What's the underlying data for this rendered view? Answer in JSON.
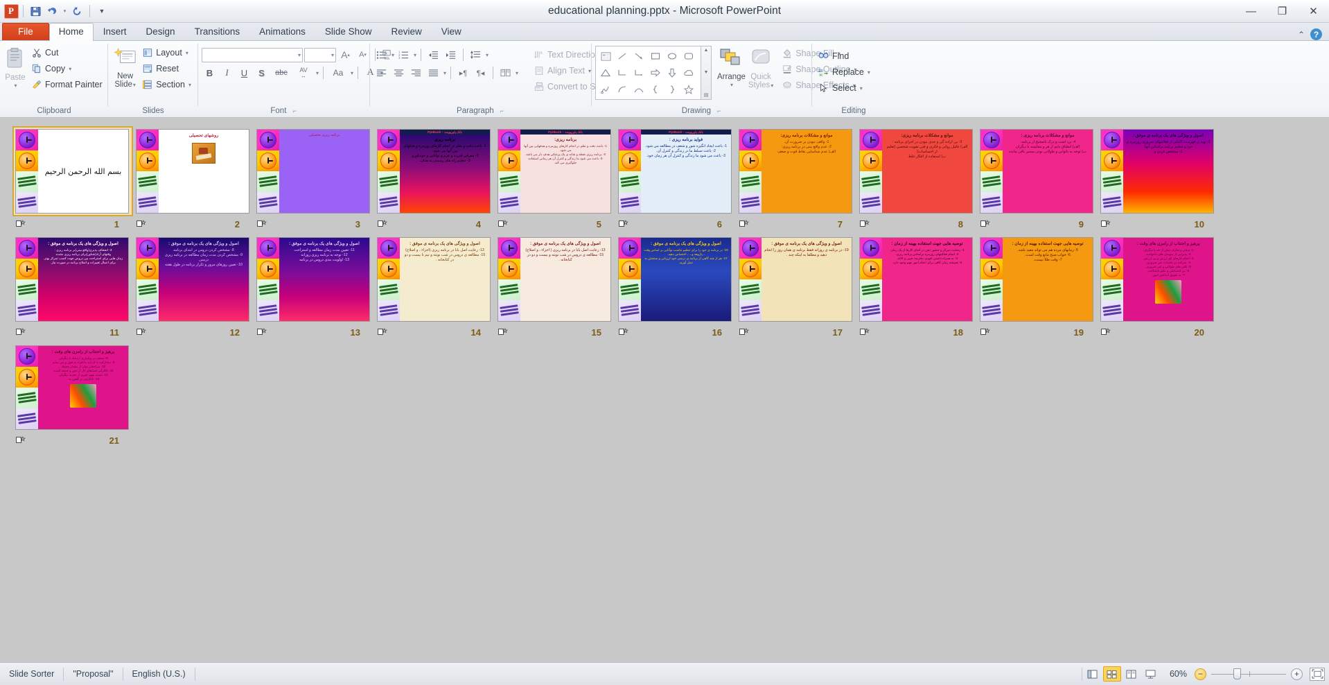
{
  "window": {
    "title": "educational planning.pptx - Microsoft PowerPoint",
    "app_logo": "P",
    "minimize": "—",
    "restore": "❐",
    "close": "✕"
  },
  "quick_access": [
    {
      "name": "save",
      "glyph": "💾"
    },
    {
      "name": "undo",
      "glyph": "↰"
    },
    {
      "name": "undo-dropdown",
      "glyph": "▾"
    },
    {
      "name": "redo",
      "glyph": "↻"
    },
    {
      "name": "customize-qat",
      "glyph": "▼"
    }
  ],
  "tabs": [
    {
      "label": "File",
      "kind": "file"
    },
    {
      "label": "Home",
      "kind": "active"
    },
    {
      "label": "Insert",
      "kind": "normal"
    },
    {
      "label": "Design",
      "kind": "normal"
    },
    {
      "label": "Transitions",
      "kind": "normal"
    },
    {
      "label": "Animations",
      "kind": "normal"
    },
    {
      "label": "Slide Show",
      "kind": "normal"
    },
    {
      "label": "Review",
      "kind": "normal"
    },
    {
      "label": "View",
      "kind": "normal"
    }
  ],
  "tab_right": {
    "minimize_ribbon": "⌃",
    "help": "?"
  },
  "ribbon": {
    "clipboard": {
      "label": "Clipboard",
      "paste": {
        "label": "Paste",
        "glyph": "📋",
        "caret": "▾"
      },
      "items": [
        {
          "label": "Cut",
          "glyph": "✂",
          "icon_name": "cut-icon"
        },
        {
          "label": "Copy",
          "glyph": "⧉",
          "icon_name": "copy-icon",
          "caret": "▾"
        },
        {
          "label": "Format Painter",
          "glyph": "🖌",
          "icon_name": "format-painter-icon"
        }
      ]
    },
    "slides": {
      "label": "Slides",
      "new_slide": {
        "label1": "New",
        "label2": "Slide",
        "glyph": "▤",
        "caret": "▾"
      },
      "items": [
        {
          "label": "Layout",
          "glyph": "▤",
          "icon_name": "layout-icon",
          "caret": "▾"
        },
        {
          "label": "Reset",
          "glyph": "▣",
          "icon_name": "reset-icon"
        },
        {
          "label": "Section",
          "glyph": "▥",
          "icon_name": "section-icon",
          "caret": "▾"
        }
      ]
    },
    "font": {
      "label": "Font",
      "font_name": "",
      "font_size": "",
      "grow": "A",
      "shrink": "A",
      "clear_formatting": "A",
      "buttons": [
        {
          "name": "bold",
          "glyph": "B"
        },
        {
          "name": "italic",
          "glyph": "I"
        },
        {
          "name": "underline",
          "glyph": "U"
        },
        {
          "name": "shadow",
          "glyph": "S"
        },
        {
          "name": "strikethrough",
          "glyph": "abc"
        },
        {
          "name": "character-spacing",
          "glyph": "AV"
        },
        {
          "name": "change-case",
          "glyph": "Aa"
        },
        {
          "name": "font-color",
          "glyph": "A"
        }
      ]
    },
    "paragraph": {
      "label": "Paragraph",
      "buttons": [
        {
          "name": "bullets",
          "glyph": "☰"
        },
        {
          "name": "numbering",
          "glyph": "☰"
        },
        {
          "name": "decrease-indent",
          "glyph": "⇤"
        },
        {
          "name": "increase-indent",
          "glyph": "⇥"
        },
        {
          "name": "line-spacing",
          "glyph": "↕"
        },
        {
          "name": "align-left",
          "glyph": "≡"
        },
        {
          "name": "align-center",
          "glyph": "≡"
        },
        {
          "name": "align-right",
          "glyph": "≡"
        },
        {
          "name": "justify",
          "glyph": "≡"
        },
        {
          "name": "ltr-text-direction",
          "glyph": "¶"
        },
        {
          "name": "rtl-text-direction",
          "glyph": "¶"
        },
        {
          "name": "columns",
          "glyph": "▦"
        }
      ],
      "items": [
        {
          "label": "Text Direction",
          "glyph": "⇅",
          "icon_name": "text-direction-icon",
          "caret": "▾"
        },
        {
          "label": "Align Text",
          "glyph": "▤",
          "icon_name": "align-text-icon",
          "caret": "▾"
        },
        {
          "label": "Convert to SmartArt",
          "glyph": "▦",
          "icon_name": "smartart-icon",
          "caret": "▾"
        }
      ]
    },
    "drawing": {
      "label": "Drawing",
      "shapes": [
        "▤",
        "╲",
        "↘",
        "▭",
        "◯",
        "▭",
        "△",
        "⌐",
        "⌐",
        "⇨",
        "⇩",
        "◠",
        "ϟ",
        "⌒",
        "⌒",
        "{",
        "}",
        "☆"
      ],
      "scroll": [
        "▲",
        "▼",
        "▤"
      ],
      "arrange": {
        "label": "Arrange",
        "caret": "▾"
      },
      "quick_styles": {
        "label1": "Quick",
        "label2": "Styles",
        "caret": "▾"
      },
      "items": [
        {
          "label": "Shape Fill",
          "glyph": "🪣",
          "icon_name": "shape-fill-icon",
          "caret": "▾"
        },
        {
          "label": "Shape Outline",
          "glyph": "✎",
          "icon_name": "shape-outline-icon",
          "caret": "▾"
        },
        {
          "label": "Shape Effects",
          "glyph": "◍",
          "icon_name": "shape-effects-icon",
          "caret": "▾"
        }
      ]
    },
    "editing": {
      "label": "Editing",
      "items": [
        {
          "label": "Find",
          "glyph": "🔍",
          "icon_name": "find-icon"
        },
        {
          "label": "Replace",
          "glyph": "ab",
          "icon_name": "replace-icon",
          "caret": "▾"
        },
        {
          "label": "Select",
          "glyph": "↖",
          "icon_name": "select-icon",
          "caret": "▾"
        }
      ]
    }
  },
  "slides": [
    {
      "number": "1",
      "selected": true,
      "kind": "calligraphy",
      "title": "",
      "body": "",
      "bg": "#ffffff",
      "color": "#000000",
      "watermark": ""
    },
    {
      "number": "2",
      "selected": false,
      "kind": "picture",
      "title": "روشهای تحصیلی",
      "body": "",
      "bg": "#ffffff",
      "color": "#c21a3a",
      "watermark": ""
    },
    {
      "number": "3",
      "selected": false,
      "kind": "plain",
      "title": "",
      "body": "برنامه ریزی تحصیلی",
      "bg": "#9b63f5",
      "color": "#b3195e",
      "watermark": ""
    },
    {
      "number": "4",
      "selected": false,
      "kind": "text",
      "title": "برنامه ریزی",
      "body": "1- باعث دقت و نظم در انجام کارهای روزمره و هدفهای بین آنها می شود.\n2- معرفی قدرت و عزم و توانایی و خودباوری\n3- تنظیم راه های رسیدن به هدف.",
      "bg": "linear-gradient(180deg,#1b0a6e 0%,#8a0c7a 45%,#e8135e 75%,#ff4500 100%)",
      "color": "#000000",
      "watermark": "PptBank - ﺑﺎﻧﮏ ﭘﺎﻭﺭﭘﻮﯾﻨﺖ"
    },
    {
      "number": "5",
      "selected": false,
      "kind": "text",
      "title": "برنامه ریزی:",
      "body": "1- باعث دقت و نظم در انجام کارهای روزمره و هدفهایی بین آنها می شود.\n2- برنامه ریزی نقطه و شانه ی یک پزشکی هدف دار می باشد.\n3- باعث می شود ما زندگی و کنترل آن هر زمانی استفاده جلوگیری می کند.",
      "bg": "#f7e0e0",
      "color": "#7a1a1a",
      "watermark": "PptBank - ﺑﺎﻧﮏ ﭘﺎﻭﺭﭘﻮﯾﻨﺖ"
    },
    {
      "number": "6",
      "selected": false,
      "kind": "text",
      "title": "فواید برنامه ریزی :",
      "body": "1- باعث ایجاد انگیزه شور و شعف در مطالعه می شود.\n2- باعث تسلط ما در زندگی و کنترل آن.\n3- باعث می شود ما زندگی و کنترل آن هر زمان خود.",
      "bg": "#e4eef8",
      "color": "#10338c",
      "watermark": "PptBank - ﺑﺎﻧﮏ ﭘﺎﻭﺭﭘﻮﯾﻨﺖ"
    },
    {
      "number": "7",
      "selected": false,
      "kind": "text",
      "title": "موانع و مشکلات برنامه ریزی:",
      "body": "1- واقف نبودن بر ضرورت آن.\n2- عدم واقع بینی در برنامه ریزی:\nالف) عدم شناسایی نقاط قوت و ضعف",
      "bg": "#f59a10",
      "color": "#7a1a00",
      "watermark": ""
    },
    {
      "number": "8",
      "selected": false,
      "kind": "text",
      "title": "موانع و مشکلات برنامه ریزی:",
      "body": "3- بی اراده گی و جدی نبودن در اجرای برنامه :\nالف) عامل روانی و فکری و فنی تقویت شخصی (تعلیم از احساسات)\nب) استفاده از افکار غلط",
      "bg": "#f0483f",
      "color": "#5a0c0c",
      "watermark": ""
    },
    {
      "number": "9",
      "selected": false,
      "kind": "text",
      "title": "موانع و مشکلات برنامه ریزی :",
      "body": "4- برد اشت و درک ناصحیح از برنامه :\nالف) انطباق دایم از هر و مقایسه با دیگران\nب) توجه به ناتوانی و طولانی بودن مسیر باقی مانده",
      "bg": "#f0268a",
      "color": "#5a0030",
      "watermark": ""
    },
    {
      "number": "10",
      "selected": false,
      "kind": "text",
      "title": "اصول و ویژگی های یک برنامه ی موفق :",
      "body": "1- تهیه ی فهرست کاملی از فعالیتهای ضروری روزمره ی خود و تنظیم برنامه براساس آنها.\n2- مشخص کردن و",
      "bg": "linear-gradient(180deg,#7a00b8 0%,#e0006a 40%,#ff2b00 75%,#ffb300 100%)",
      "color": "#1a0033",
      "watermark": ""
    },
    {
      "number": "11",
      "selected": false,
      "kind": "text",
      "title": "اصول و ویژگی های یک برنامه ی موفق :",
      "body": "3- انعطاف پذیری(واقع بینی)بر برنامه ریزی :\nوقتهای آزاد(شناور)برای برنامه ریزی نشده.\nزمان هایی برای استراحت بین دروس جهت کسب تمرکز بهتر.\nبرای اعمال تغییرات و اصلاح برنامه در صورت نیاز.",
      "bg": "linear-gradient(180deg,#2e0a6e 0%,#8a0c6e 40%,#d4006a 70%,#ff0a6a 100%)",
      "color": "#ffffff",
      "watermark": ""
    },
    {
      "number": "12",
      "selected": false,
      "kind": "text",
      "title": "اصول و ویژگی های یک برنامه ی موفق :",
      "body": "8- مشخص کردن دروس در ابتدای برنامه\n9- مشخص کردن مدت زمان مطالعه در برنامه ریزی درسی\n10- تعیین روزهای مرور و تکرار برنامه در طول هفته",
      "bg": "linear-gradient(180deg,#1a0a6e 0%,#6a0c9a 35%,#c4007a 65%,#ff2b6a 100%)",
      "color": "#d8c8f0",
      "watermark": ""
    },
    {
      "number": "13",
      "selected": false,
      "kind": "text",
      "title": "اصول و ویژگی های یک برنامه ی موفق :",
      "body": "11- تعیین مدت زمان مطالعه و استراحت\n12- توجه به برنامه ریزی روزانه\n13- اولویت بندی دروس در برنامه",
      "bg": "linear-gradient(180deg,#2a0a8e 0%,#7a0c9a 40%,#c4007a 70%,#ff2b6a 100%)",
      "color": "#e0d0f5",
      "watermark": ""
    },
    {
      "number": "14",
      "selected": false,
      "kind": "text",
      "title": "اصول و ویژگی های یک برنامه ی موفق :",
      "body": "13- رعایت اصل بابا در برنامه ریزی (اجزاء ، و اصلاح)\n15- مطالعه ی دروس در شب نوبته و نیم تا بیست و دو در کتابخانه .",
      "bg": "#f5ecd0",
      "color": "#7a3a00",
      "watermark": ""
    },
    {
      "number": "15",
      "selected": false,
      "kind": "text",
      "title": "اصول و ویژگی های یک برنامه ی موفق :",
      "body": "13- رعایت اصل بابا در برنامه ریزی ( اجزاء ، و اصلاح)\n15- مطالعه ی دروس در شب نوبته و بیست و دو در کتابخانه .",
      "bg": "#f7eadf",
      "color": "#7a1a1a",
      "watermark": ""
    },
    {
      "number": "16",
      "selected": false,
      "kind": "text",
      "title": "اصول و ویژگی های یک برنامه ی موفق :",
      "body": "16- در برنامه ی خود را برای تنظیم تناسب نوآنایی بر اساس وقت ، پاژوهه و... ، اختصاص دهید.\n17- هر از چند گاهی از برنامه ی درسی خود ارزیابی و سنجش به عمل آورید.",
      "bg": "linear-gradient(180deg,#1a2a8e 0%,#2a4abe 40%,#1a1a7a 100%)",
      "color": "#ffd400",
      "watermark": ""
    },
    {
      "number": "17",
      "selected": false,
      "kind": "text",
      "title": "اصول و ویژگی های یک برنامه ی موفق :",
      "body": "19- در برنامه ی روزانه فقط برنامه ی همان روز را انجام دهید و مطلقا به اینکه چند .",
      "bg": "#f2e3b8",
      "color": "#7a1a00",
      "watermark": ""
    },
    {
      "number": "18",
      "selected": false,
      "kind": "text",
      "title": "توصیه هایی جهت استفاده بهینه از زمان :",
      "body": "1- رضایت تمرکز و حضور ذهن در کمای کارها از یک زمان.\n2- انجام فعالیتهای روزمره براساس برنامه ریزی.\n3- به همراه داشتن تقویم، دفترچه جیبی و کاغذ.\n4- همیشه زمان کافی برای انجام امور مهم وجود دارد.",
      "bg": "#f0268a",
      "color": "#3a0020",
      "watermark": ""
    },
    {
      "number": "19",
      "selected": false,
      "kind": "text",
      "title": "توصیه هایی جهت استفاده بهینه از زمان :",
      "body": "5- زمانهای مرده هم می تواند مفید باشد.\n6- خواب صبح مانع وقت است.\n7- وقت طلا نیست.",
      "bg": "#f59a10",
      "color": "#5a1a00",
      "watermark": ""
    },
    {
      "number": "20",
      "selected": false,
      "kind": "text",
      "title": "پرهیز و اجتناب از رامزن های وقت :",
      "body": "1- سخن و تعارف بیش از حد با دیگران.\n2- پذیرایی از میهمان های ناخوانده.\n3- انجام کارهای کم ارزش و بی ارزش.\n4- شرکت در جلسات غیر ضروری.\n5- تلفن های طولانی و غیر ضروری.\n6- بی انضباطی و نظم ناشناخته.\n7- به تعویق انداختن امور.",
      "bg": "#e0148a",
      "color": "#5a0030",
      "watermark": ""
    },
    {
      "number": "21",
      "selected": false,
      "kind": "text",
      "title": "پرهیز و اجتناب از رامزن های وقت :",
      "body": "8- ضعف در برقراری ارتباط با دیگران.\n9- مشارکت نا کارآمد با افراد به قول و می نماید.\n10- مراجعان میان از مقدار محیط.\n11- ناکارآیی فضاهای کار از ذهن و جمعه کننده.\n12- تمدید مهم، قبری از تجربه دیگران.\n13- ناکارایی در گفتن به .",
      "bg": "#e0148a",
      "color": "#5a0030",
      "watermark": ""
    }
  ],
  "status": {
    "view_mode": "Slide Sorter",
    "theme": "\"Proposal\"",
    "language": "English (U.S.)",
    "views": [
      {
        "name": "normal-view",
        "glyph": "▥"
      },
      {
        "name": "slide-sorter-view",
        "glyph": "▦",
        "active": true
      },
      {
        "name": "reading-view",
        "glyph": "📖"
      },
      {
        "name": "slide-show-view",
        "glyph": "🖵"
      }
    ],
    "zoom": "60%",
    "zoom_out": "−",
    "zoom_in": "+",
    "fit_window": "⛶"
  }
}
